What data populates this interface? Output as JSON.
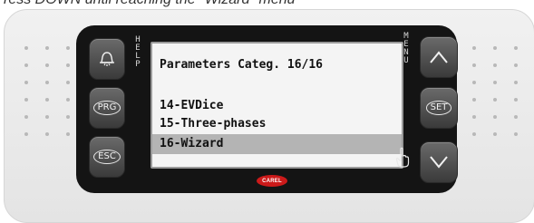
{
  "caption": "ress DOWN until reaching the \"Wizard\" menu",
  "left_side_label": [
    "H",
    "E",
    "L",
    "P"
  ],
  "right_side_label": [
    "M",
    "E",
    "N",
    "U"
  ],
  "screen": {
    "title": "Parameters Categ. 16/16",
    "items": [
      {
        "label": "14-EVDice",
        "selected": false
      },
      {
        "label": "15-Three-phases",
        "selected": false
      },
      {
        "label": "16-Wizard",
        "selected": true
      }
    ]
  },
  "buttons": {
    "alarm": {
      "icon": "bell-icon"
    },
    "prg": {
      "label": "PRG"
    },
    "esc": {
      "label": "ESC"
    },
    "up": {
      "icon": "chevron-up-icon"
    },
    "set": {
      "label": "SET"
    },
    "down": {
      "icon": "chevron-down-icon"
    }
  },
  "brand": "CAREL",
  "colors": {
    "bezel": "#141414",
    "screen": "#f4f4f4",
    "selection": "#b4b4b4",
    "brand": "#cc1a1a"
  }
}
